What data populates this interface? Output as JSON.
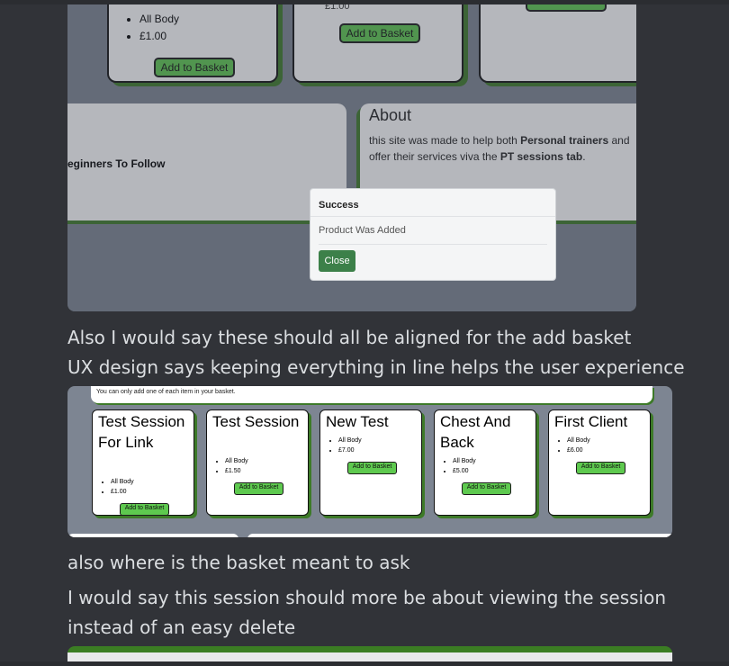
{
  "screenshot1": {
    "card_a": {
      "bullets": [
        "All Body",
        "£1.00"
      ],
      "button": "Add to Basket"
    },
    "card_b": {
      "price_fragment": "£1.00",
      "button": "Add to Basket"
    },
    "card_c": {
      "button": ""
    },
    "left_panel": {
      "text": "eginners To Follow"
    },
    "about": {
      "heading": "About",
      "line1_pre": "this site was made to help both ",
      "line1_bold": "Personal trainers",
      "line1_post": " and",
      "line2_pre": "offer their services viva the ",
      "line2_bold": "PT sessions tab",
      "line2_post": "."
    },
    "toast": {
      "title": "Success",
      "message": "Product Was Added",
      "close": "Close"
    }
  },
  "message1": {
    "line1": "Also I would say these should all be aligned for the add basket",
    "line2": "UX design says keeping everything in line helps the user experience"
  },
  "screenshot2": {
    "notice": "You can only add one of each item in your basket.",
    "cards": [
      {
        "title": "Test Session For Link",
        "bullets": [
          "All Body",
          "£1.00"
        ],
        "button": "Add to Basket"
      },
      {
        "title": "Test Session",
        "bullets": [
          "All Body",
          "£1.50"
        ],
        "button": "Add to Basket"
      },
      {
        "title": "New Test",
        "bullets": [
          "All Body",
          "£7.00"
        ],
        "button": "Add to Basket"
      },
      {
        "title": "Chest And Back",
        "bullets": [
          "All Body",
          "£5.00"
        ],
        "button": "Add to Basket"
      },
      {
        "title": "First Client",
        "bullets": [
          "All Body",
          "£6.00"
        ],
        "button": "Add to Basket"
      }
    ]
  },
  "message2": {
    "line1": "also where is the basket meant to ask"
  },
  "message3": {
    "line1": "I would say this session should more be about viewing the session",
    "line2": "instead of an easy delete"
  },
  "colors": {
    "background": "#313338",
    "card_shadow_green": "#3d7a28",
    "button_green": "#5ec94f",
    "close_button": "#3c8049",
    "screenshot_bg": "#7d8592"
  }
}
